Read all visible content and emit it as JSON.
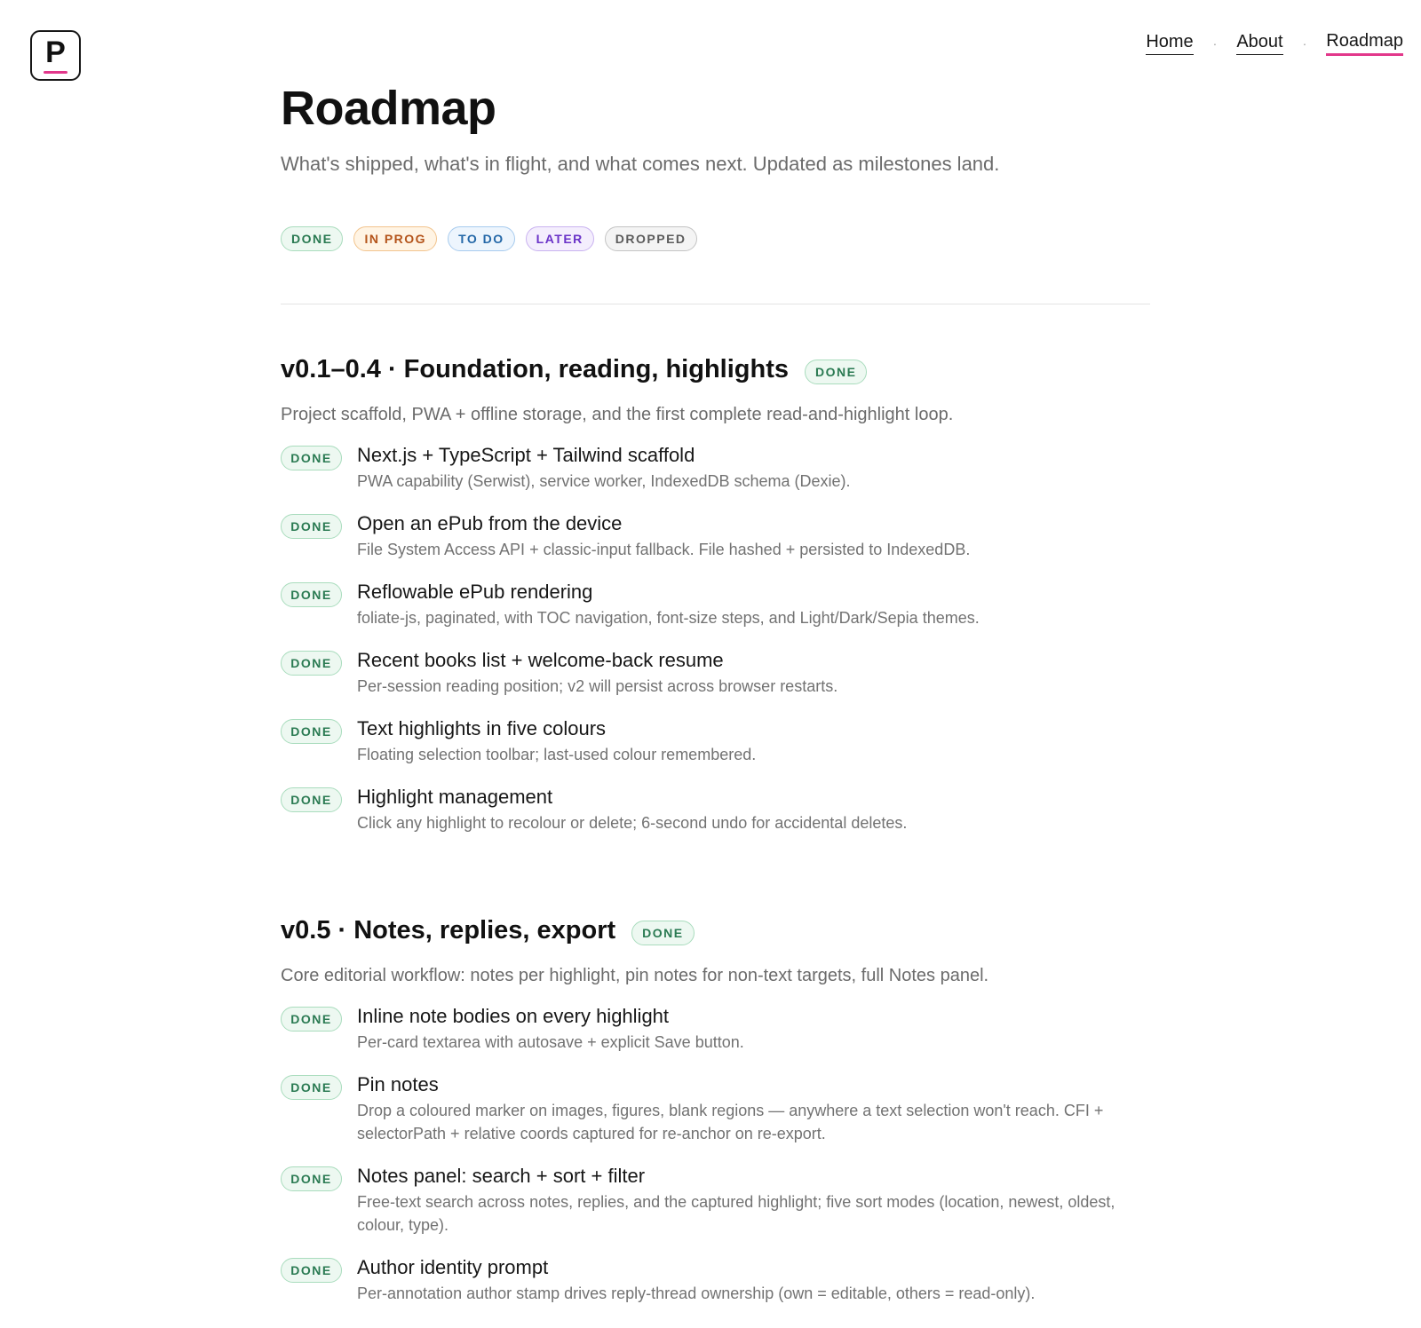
{
  "logo": {
    "letter": "P"
  },
  "nav": {
    "home": "Home",
    "about": "About",
    "roadmap": "Roadmap",
    "sep": "·"
  },
  "page": {
    "title": "Roadmap",
    "subtitle": "What's shipped, what's in flight, and what comes next. Updated as milestones land."
  },
  "legend": [
    "DONE",
    "IN PROG",
    "TO DO",
    "LATER",
    "DROPPED"
  ],
  "colors": {
    "accent": "#e2388b",
    "done": "#2a7a52",
    "in_prog": "#b4541b",
    "to_do": "#2468a8",
    "later": "#6a33c8",
    "dropped": "#5c5c5c"
  },
  "sections": [
    {
      "title": "v0.1–0.4 · Foundation, reading, highlights",
      "status": "DONE",
      "description": "Project scaffold, PWA + offline storage, and the first complete read-and-highlight loop.",
      "items": [
        {
          "status": "DONE",
          "title": "Next.js + TypeScript + Tailwind scaffold",
          "description": "PWA capability (Serwist), service worker, IndexedDB schema (Dexie)."
        },
        {
          "status": "DONE",
          "title": "Open an ePub from the device",
          "description": "File System Access API + classic-input fallback. File hashed + persisted to IndexedDB."
        },
        {
          "status": "DONE",
          "title": "Reflowable ePub rendering",
          "description": "foliate-js, paginated, with TOC navigation, font-size steps, and Light/Dark/Sepia themes."
        },
        {
          "status": "DONE",
          "title": "Recent books list + welcome-back resume",
          "description": "Per-session reading position; v2 will persist across browser restarts."
        },
        {
          "status": "DONE",
          "title": "Text highlights in five colours",
          "description": "Floating selection toolbar; last-used colour remembered."
        },
        {
          "status": "DONE",
          "title": "Highlight management",
          "description": "Click any highlight to recolour or delete; 6-second undo for accidental deletes."
        }
      ]
    },
    {
      "title": "v0.5 · Notes, replies, export",
      "status": "DONE",
      "description": "Core editorial workflow: notes per highlight, pin notes for non-text targets, full Notes panel.",
      "items": [
        {
          "status": "DONE",
          "title": "Inline note bodies on every highlight",
          "description": "Per-card textarea with autosave + explicit Save button."
        },
        {
          "status": "DONE",
          "title": "Pin notes",
          "description": "Drop a coloured marker on images, figures, blank regions — anywhere a text selection won't reach. CFI + selectorPath + relative coords captured for re-anchor on re-export."
        },
        {
          "status": "DONE",
          "title": "Notes panel: search + sort + filter",
          "description": "Free-text search across notes, replies, and the captured highlight; five sort modes (location, newest, oldest, colour, type)."
        },
        {
          "status": "DONE",
          "title": "Author identity prompt",
          "description": "Per-annotation author stamp drives reply-thread ownership (own = editable, others = read-only)."
        }
      ]
    }
  ]
}
